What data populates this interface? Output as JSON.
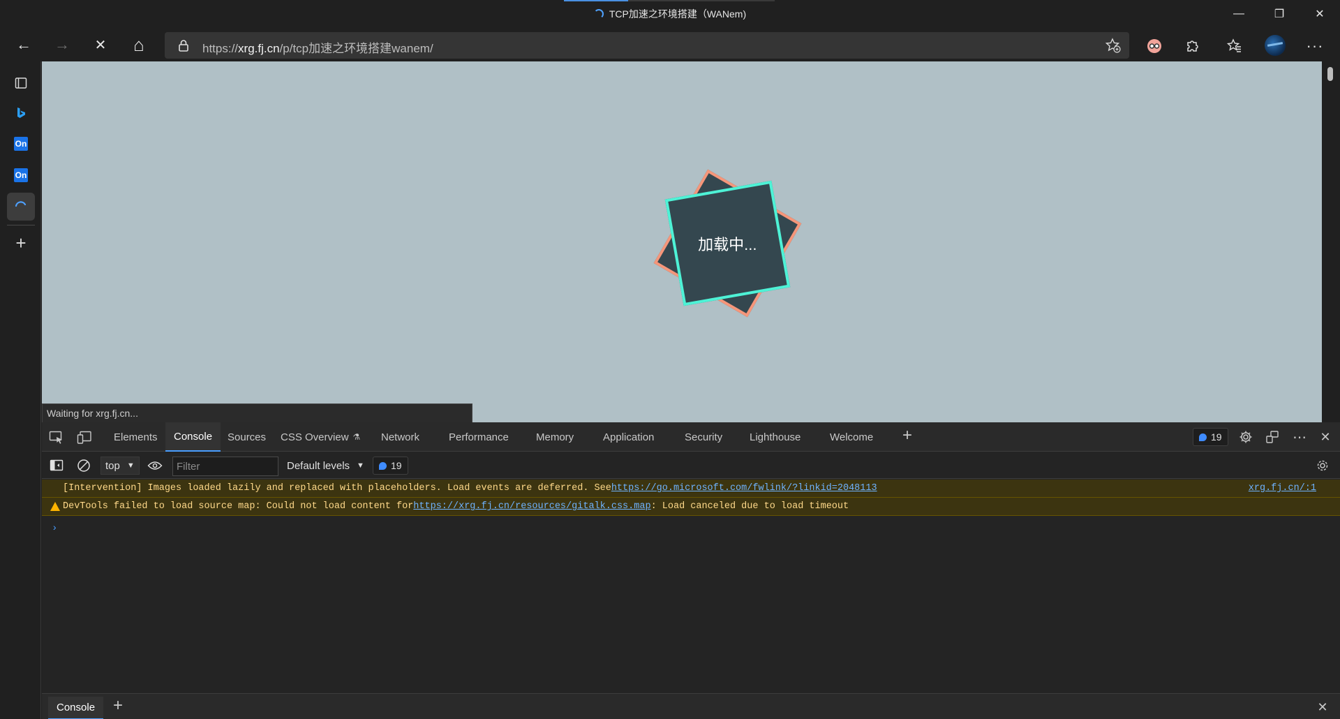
{
  "window": {
    "title": "TCP加速之环境搭建（WANem)",
    "controls": {
      "minimize": "—",
      "restore": "❐",
      "close": "✕"
    }
  },
  "nav": {
    "back": "←",
    "forward": "→",
    "stop": "✕",
    "home": "⌂",
    "url_scheme": "https://",
    "url_host": "xrg.fj.cn",
    "url_path": "/p/tcp加速之环境搭建wanem/"
  },
  "toolbar": {
    "extensions_icon": "puzzle-icon",
    "favorites_icon": "favorites-icon",
    "more": "···"
  },
  "sidebar": {
    "items": [
      {
        "name": "tab-actions",
        "label": ""
      },
      {
        "name": "bing",
        "label": "b"
      },
      {
        "name": "outlook-1",
        "label": "On"
      },
      {
        "name": "outlook-2",
        "label": "On"
      },
      {
        "name": "loading-tab",
        "label": ""
      },
      {
        "name": "add",
        "label": "+"
      }
    ]
  },
  "page": {
    "loader_text": "加载中...",
    "status_text": "Waiting for xrg.fj.cn..."
  },
  "devtools": {
    "tabs": [
      "Elements",
      "Console",
      "Sources",
      "CSS Overview",
      "Network",
      "Performance",
      "Memory",
      "Application",
      "Security",
      "Lighthouse",
      "Welcome"
    ],
    "active_tab": "Console",
    "add_tab": "+",
    "issues_count": "19",
    "context": "top",
    "filter_placeholder": "Filter",
    "levels_label": "Default levels",
    "toolbar_issues_count": "19",
    "messages": [
      {
        "text": "[Intervention] Images loaded lazily and replaced with placeholders. Load events are deferred. See ",
        "link": "https://go.microsoft.com/fwlink/?linkid=2048113",
        "after": "",
        "source": "xrg.fj.cn/:1"
      },
      {
        "text": "DevTools failed to load source map: Could not load content for ",
        "link": "https://xrg.fj.cn/resources/gitalk.css.map",
        "after": ": Load canceled due to load timeout",
        "source": ""
      }
    ],
    "prompt": "›",
    "drawer_tab": "Console",
    "drawer_add": "+",
    "drawer_close": "✕"
  },
  "colors": {
    "page_bg": "#b0c0c6",
    "loader_fill": "#34474f",
    "loader_border_front": "#4ef2d6",
    "loader_border_back": "#f5967a",
    "accent_blue": "#4a9eff",
    "warning_bg": "#3c3410",
    "warning_text": "#ffd98a"
  }
}
